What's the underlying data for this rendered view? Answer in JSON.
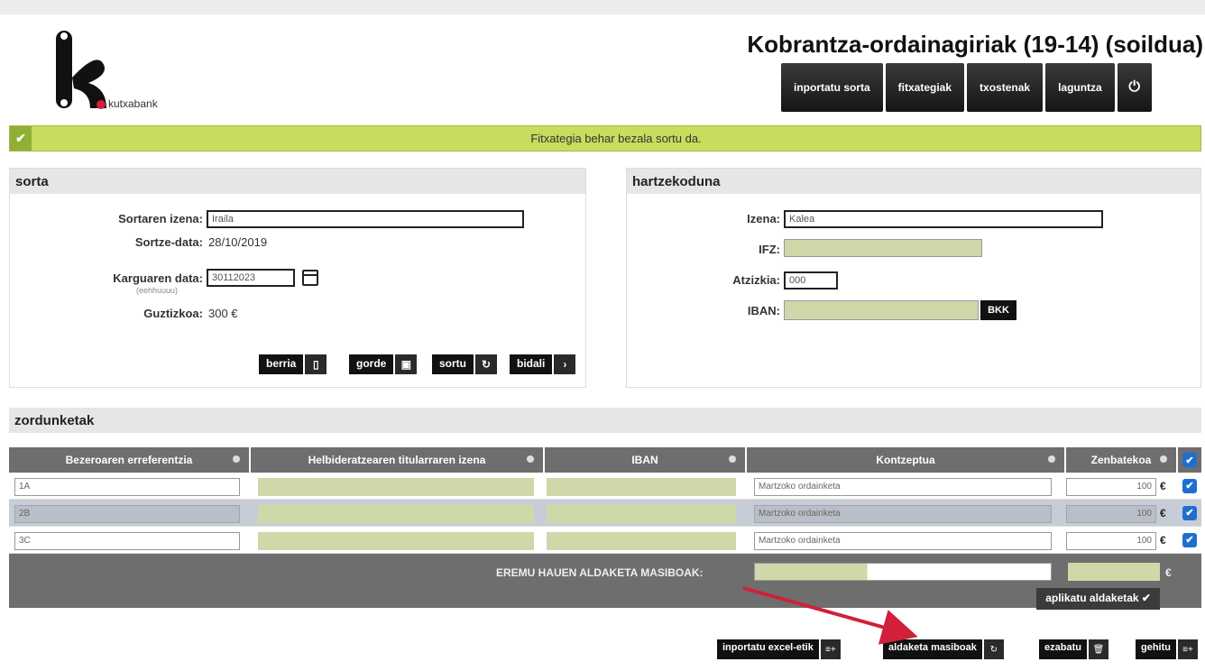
{
  "header": {
    "logo_text": "kutxabank",
    "title": "Kobrantza-ordainagiriak (19-14) (soildua)"
  },
  "nav": {
    "items": [
      "inportatu sorta",
      "fitxategiak",
      "txostenak",
      "laguntza"
    ],
    "power_icon": "power-icon"
  },
  "alert": {
    "message": "Fitxategia behar bezala sortu da."
  },
  "sorta": {
    "title": "sorta",
    "name_label": "Sortaren izena:",
    "name_value": "Iraila",
    "date_label": "Sortze-data:",
    "date_value": "28/10/2019",
    "charge_label": "Karguaren data:",
    "charge_hint": "(eehhuuuu)",
    "charge_value": "30112023",
    "total_label": "Guztizkoa:",
    "total_value": "300 €",
    "buttons": {
      "new": "berria",
      "save": "gorde",
      "create": "sortu",
      "send": "bidali"
    }
  },
  "hartzekoduna": {
    "title": "hartzekoduna",
    "name_label": "Izena:",
    "name_value": "Kalea",
    "ifz_label": "IFZ:",
    "suffix_label": "Atzizkia:",
    "suffix_value": "000",
    "iban_label": "IBAN:",
    "bkk_label": "BKK"
  },
  "zordunketak": {
    "title": "zordunketak",
    "columns": [
      "Bezeroaren erreferentzia",
      "Helbideratzearen titularraren izena",
      "IBAN",
      "Kontzeptua",
      "Zenbatekoa"
    ],
    "rows": [
      {
        "ref": "1A",
        "concept": "Martzoko ordainketa",
        "amount": "100",
        "currency": "€"
      },
      {
        "ref": "2B",
        "concept": "Martzoko ordainketa",
        "amount": "100",
        "currency": "€"
      },
      {
        "ref": "3C",
        "concept": "Martzoko ordainketa",
        "amount": "100",
        "currency": "€"
      }
    ],
    "mass_label": "EREMU HAUEN ALDAKETA MASIBOAK:",
    "mass_currency": "€",
    "apply_label": "aplikatu aldaketak ✔"
  },
  "bottom_buttons": [
    "inportatu excel-etik",
    "aldaketa masiboak",
    "ezabatu",
    "gehitu"
  ],
  "colors": {
    "success_bg": "#c9dc5e",
    "accent_blue": "#1f6fd1",
    "arrow_red": "#d0203a",
    "masked_green": "#cfd8a9"
  }
}
